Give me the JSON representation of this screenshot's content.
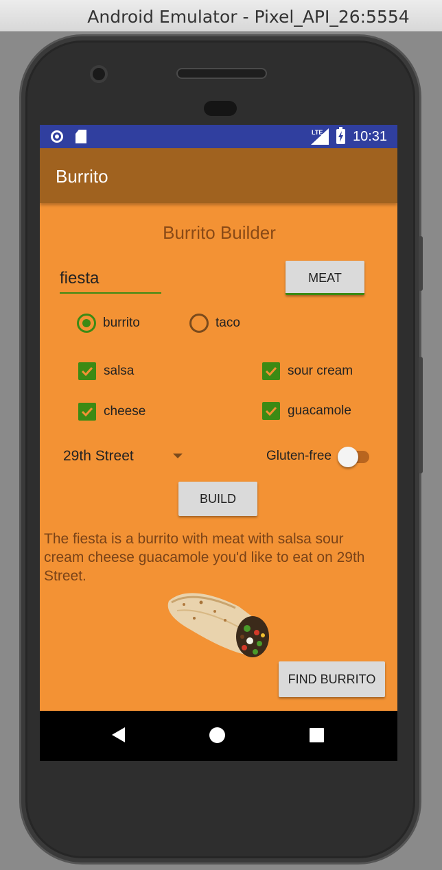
{
  "window": {
    "title": "Android Emulator - Pixel_API_26:5554"
  },
  "statusbar": {
    "time": "10:31",
    "network": "LTE"
  },
  "appbar": {
    "title": "Burrito"
  },
  "main": {
    "heading": "Burrito Builder",
    "name_input": {
      "value": "fiesta"
    },
    "meat_button": "MEAT",
    "radios": [
      {
        "label": "burrito",
        "checked": true
      },
      {
        "label": "taco",
        "checked": false
      }
    ],
    "checkboxes": [
      {
        "label": "salsa",
        "checked": true
      },
      {
        "label": "sour cream",
        "checked": true
      },
      {
        "label": "cheese",
        "checked": true
      },
      {
        "label": "guacamole",
        "checked": true
      }
    ],
    "location_spinner": {
      "selected": "29th Street"
    },
    "gluten_free": {
      "label": "Gluten-free",
      "on": false
    },
    "build_button": "BUILD",
    "description": "The fiesta is a burrito with meat with  salsa sour cream cheese guacamole you'd like to eat on 29th Street.",
    "find_button": "FIND BURRITO"
  },
  "colors": {
    "statusbar": "#303f9f",
    "appbar": "#a0621f",
    "background": "#f39234",
    "accent": "#3c8a14"
  }
}
